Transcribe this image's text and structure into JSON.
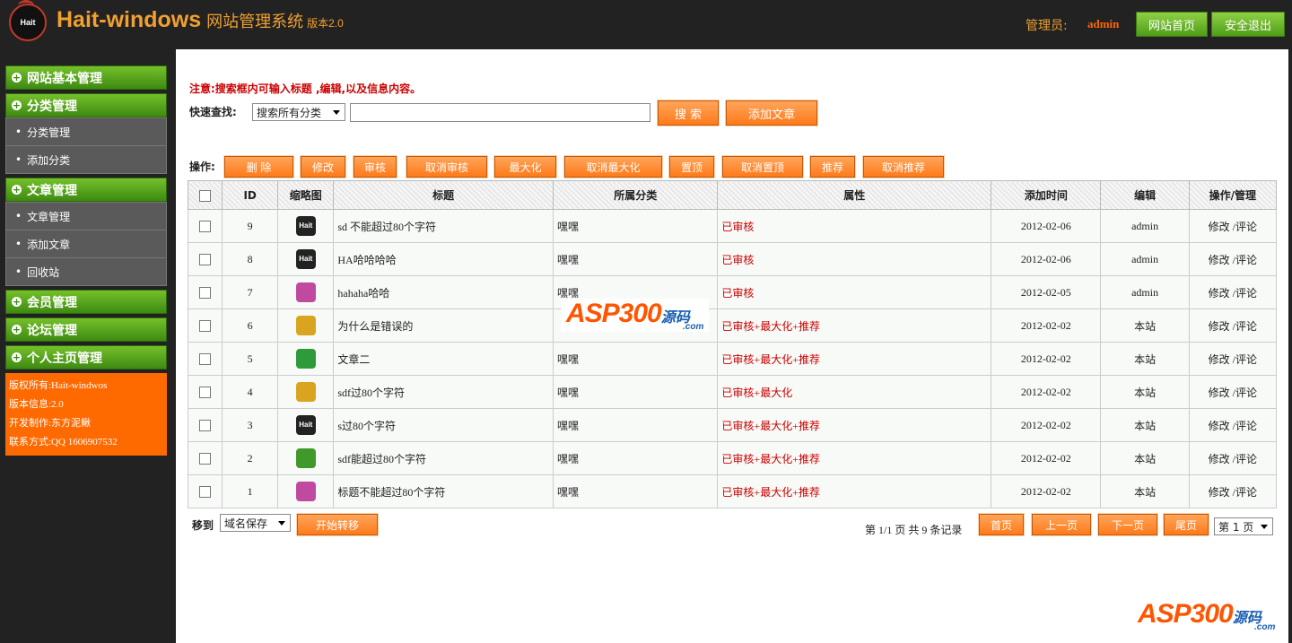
{
  "header": {
    "logo_text": "Hait",
    "app_name": "Hait-windows",
    "system_name": "网站管理系统",
    "version": "版本2.0",
    "admin_label": "管理员:",
    "admin_name": "admin",
    "btn_home": "网站首页",
    "btn_logout": "安全退出"
  },
  "sidebar": {
    "groups": [
      {
        "label": "网站基本管理",
        "items": []
      },
      {
        "label": "分类管理",
        "items": [
          "分类管理",
          "添加分类"
        ]
      },
      {
        "label": "文章管理",
        "items": [
          "文章管理",
          "添加文章",
          "回收站"
        ]
      },
      {
        "label": "会员管理",
        "items": []
      },
      {
        "label": "论坛管理",
        "items": []
      },
      {
        "label": "个人主页管理",
        "items": []
      }
    ],
    "info": [
      "版权所有:Hait-windwos",
      "版本信息:2.0",
      "开发制作:东方泥鳅",
      "联系方式:QQ 1606907532"
    ]
  },
  "main": {
    "notice": "注意:搜索框内可输入标题 ,编辑,以及信息内容。",
    "search_label": "快速查找:",
    "search_select": "搜索所有分类",
    "search_value": "",
    "btn_search": "搜 索",
    "btn_add": "添加文章",
    "ops_label": "操作:",
    "ops": [
      "删 除",
      "修改",
      "审核",
      "取消审核",
      "最大化",
      "取消最大化",
      "置顶",
      "取消置顶",
      "推荐",
      "取消推荐"
    ],
    "columns": [
      "ID",
      "缩略图",
      "标题",
      "所属分类",
      "属性",
      "添加时间",
      "编辑",
      "操作/管理"
    ],
    "rows": [
      {
        "id": "9",
        "thumb": "hait",
        "title": "sd 不能超过80个字符",
        "cat": "嘿嘿",
        "attr": "已审核",
        "date": "2012-02-06",
        "editor": "admin"
      },
      {
        "id": "8",
        "thumb": "hait",
        "title": "HA哈哈哈哈",
        "cat": "嘿嘿",
        "attr": "已审核",
        "date": "2012-02-06",
        "editor": "admin"
      },
      {
        "id": "7",
        "thumb": "pink",
        "title": "hahaha哈哈",
        "cat": "嘿嘿",
        "attr": "已审核",
        "date": "2012-02-05",
        "editor": "admin"
      },
      {
        "id": "6",
        "thumb": "folder",
        "title": "为什么是错误的",
        "cat": "",
        "attr": "已审核+最大化+推荐",
        "date": "2012-02-02",
        "editor": "本站"
      },
      {
        "id": "5",
        "thumb": "excel",
        "title": "文章二",
        "cat": "嘿嘿",
        "attr": "已审核+最大化+推荐",
        "date": "2012-02-02",
        "editor": "本站"
      },
      {
        "id": "4",
        "thumb": "folder",
        "title": "sdf过80个字符",
        "cat": "嘿嘿",
        "attr": "已审核+最大化",
        "date": "2012-02-02",
        "editor": "本站"
      },
      {
        "id": "3",
        "thumb": "hait",
        "title": "s过80个字符",
        "cat": "嘿嘿",
        "attr": "已审核+最大化+推荐",
        "date": "2012-02-02",
        "editor": "本站"
      },
      {
        "id": "2",
        "thumb": "green",
        "title": "sdf能超过80个字符",
        "cat": "嘿嘿",
        "attr": "已审核+最大化+推荐",
        "date": "2012-02-02",
        "editor": "本站"
      },
      {
        "id": "1",
        "thumb": "pink",
        "title": "标题不能超过80个字符",
        "cat": "嘿嘿",
        "attr": "已审核+最大化+推荐",
        "date": "2012-02-02",
        "editor": "本站"
      }
    ],
    "row_edit": "修改",
    "row_sep": "/",
    "row_comment": "评论",
    "move_label": "移到",
    "move_select": "域名保存",
    "btn_move": "开始转移",
    "pager_text": "第 1/1 页 共 9 条记录",
    "btn_first": "首页",
    "btn_prev": "上一页",
    "btn_next": "下一页",
    "btn_last": "尾页",
    "page_select": "第 1 页"
  },
  "watermark": {
    "brand": "ASP300",
    "cn": "源码",
    "domain": ".com"
  },
  "colors": {
    "accent_green": "#5aa81e",
    "accent_orange": "#ff7a1a",
    "attr_red": "#cc0000",
    "title_gold": "#f0a030"
  }
}
